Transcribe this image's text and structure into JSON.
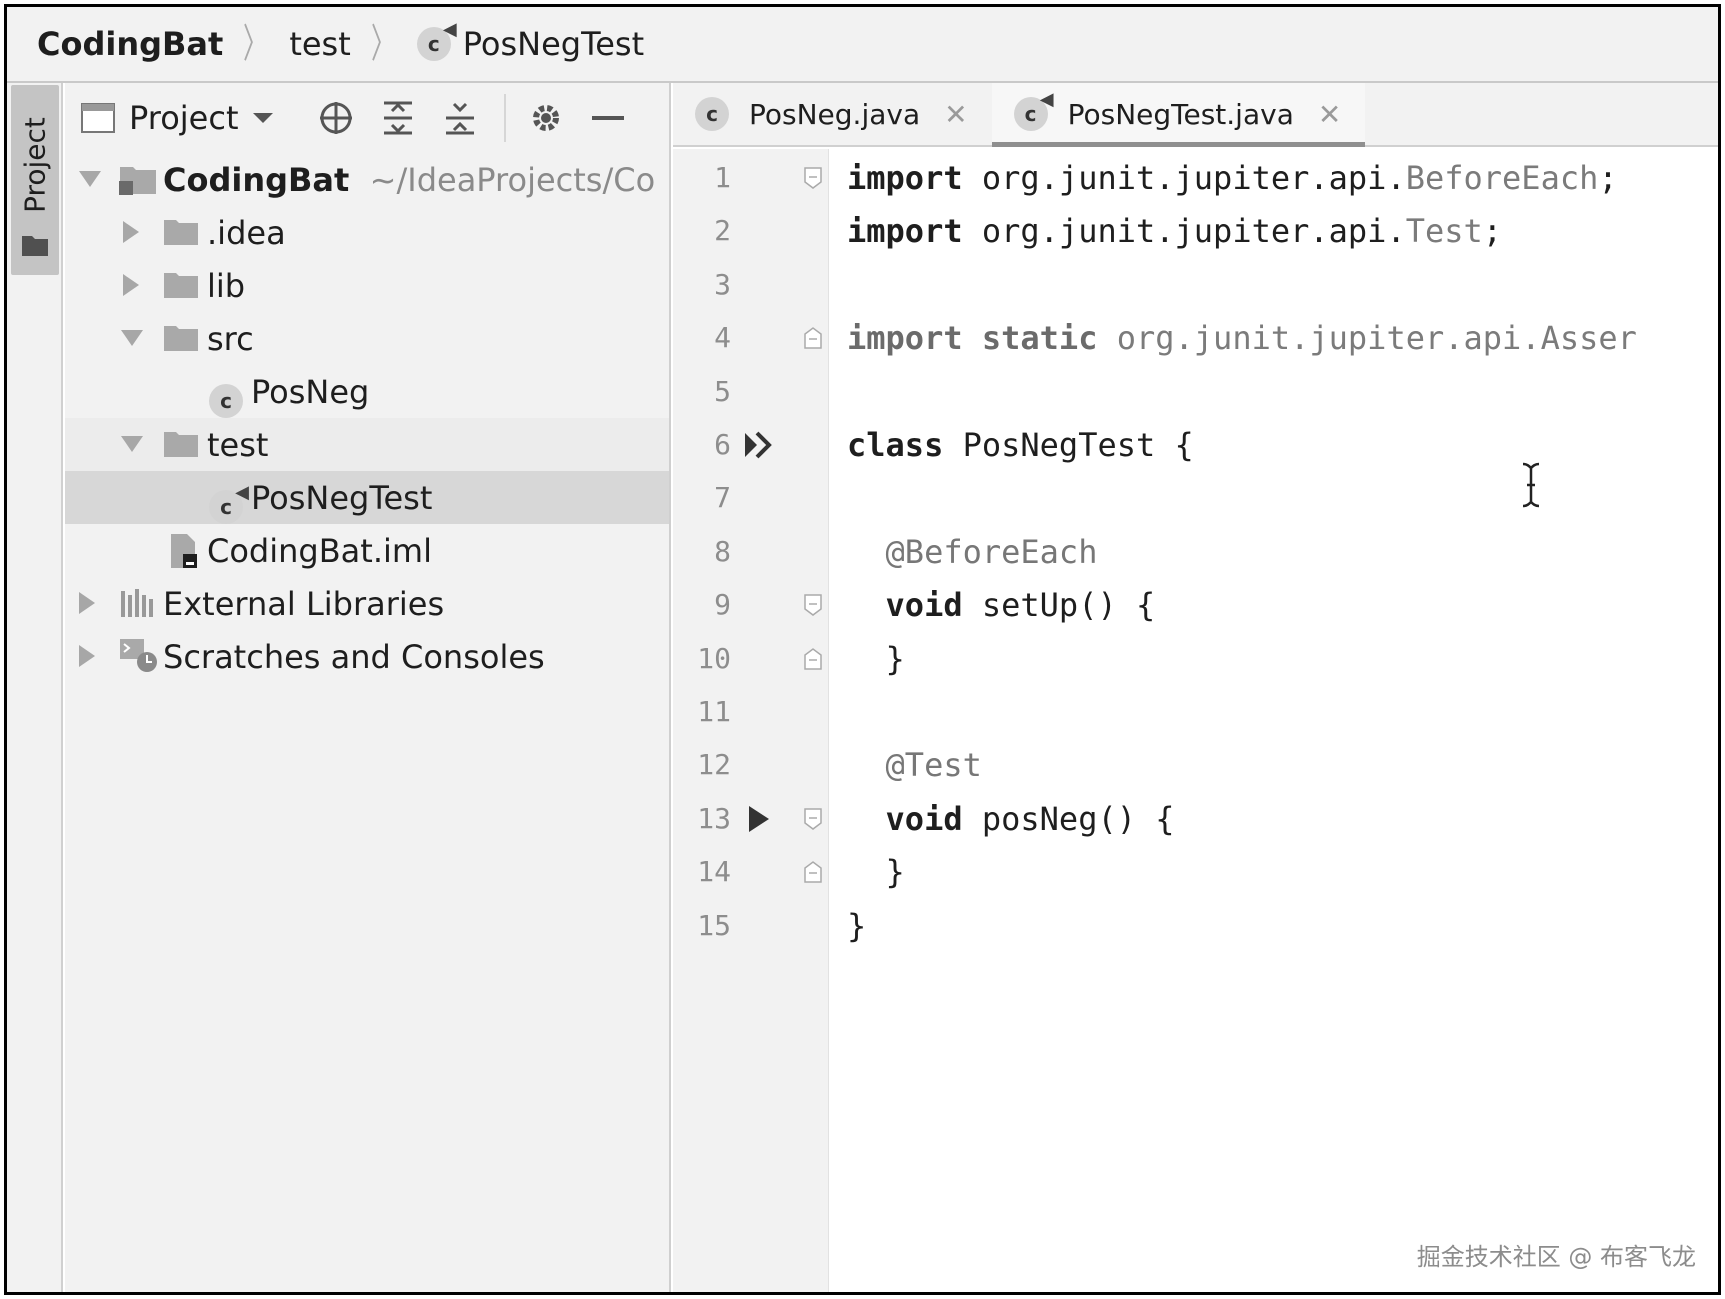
{
  "breadcrumb": {
    "project": "CodingBat",
    "folder": "test",
    "file": "PosNegTest"
  },
  "side_stripe": {
    "label": "Project"
  },
  "project_panel": {
    "selector_label": "Project",
    "tree": [
      {
        "label": "CodingBat",
        "suffix": "~/IdeaProjects/Co",
        "icon": "project-folder-icon"
      },
      {
        "label": ".idea",
        "icon": "folder-icon"
      },
      {
        "label": "lib",
        "icon": "folder-icon"
      },
      {
        "label": "src",
        "icon": "folder-icon"
      },
      {
        "label": "PosNeg",
        "icon": "java-class-icon"
      },
      {
        "label": "test",
        "icon": "folder-icon"
      },
      {
        "label": "PosNegTest",
        "icon": "java-test-class-icon"
      },
      {
        "label": "CodingBat.iml",
        "icon": "iml-file-icon"
      },
      {
        "label": "External Libraries",
        "icon": "libraries-icon"
      },
      {
        "label": "Scratches and Consoles",
        "icon": "scratches-icon"
      }
    ]
  },
  "tabs": [
    {
      "label": "PosNeg.java",
      "active": false
    },
    {
      "label": "PosNegTest.java",
      "active": true
    }
  ],
  "editor": {
    "current_line": 7,
    "lines": [
      {
        "n": "1",
        "parts": [
          "import",
          " org.junit.jupiter.api.",
          "BeforeEach",
          ";"
        ]
      },
      {
        "n": "2",
        "parts": [
          "import",
          " org.junit.jupiter.api.",
          "Test",
          ";"
        ]
      },
      {
        "n": "3",
        "parts": []
      },
      {
        "n": "4",
        "parts": [
          "import static",
          " org.junit.jupiter.api.Asser"
        ]
      },
      {
        "n": "5",
        "parts": []
      },
      {
        "n": "6",
        "parts": [
          "class",
          " PosNegTest {"
        ]
      },
      {
        "n": "7",
        "parts": []
      },
      {
        "n": "8",
        "parts": [
          "@BeforeEach"
        ]
      },
      {
        "n": "9",
        "parts": [
          "void",
          " setUp() {"
        ]
      },
      {
        "n": "10",
        "parts": [
          "}"
        ]
      },
      {
        "n": "11",
        "parts": []
      },
      {
        "n": "12",
        "parts": [
          "@Test"
        ]
      },
      {
        "n": "13",
        "parts": [
          "void",
          " posNeg() {"
        ]
      },
      {
        "n": "14",
        "parts": [
          "}"
        ]
      },
      {
        "n": "15",
        "parts": [
          "}"
        ]
      }
    ]
  },
  "watermark": "掘金技术社区 @ 布客飞龙",
  "colors": {
    "panel_bg": "#f2f2f2",
    "selection": "#d7d7d7",
    "current_line": "#fbfbef"
  }
}
